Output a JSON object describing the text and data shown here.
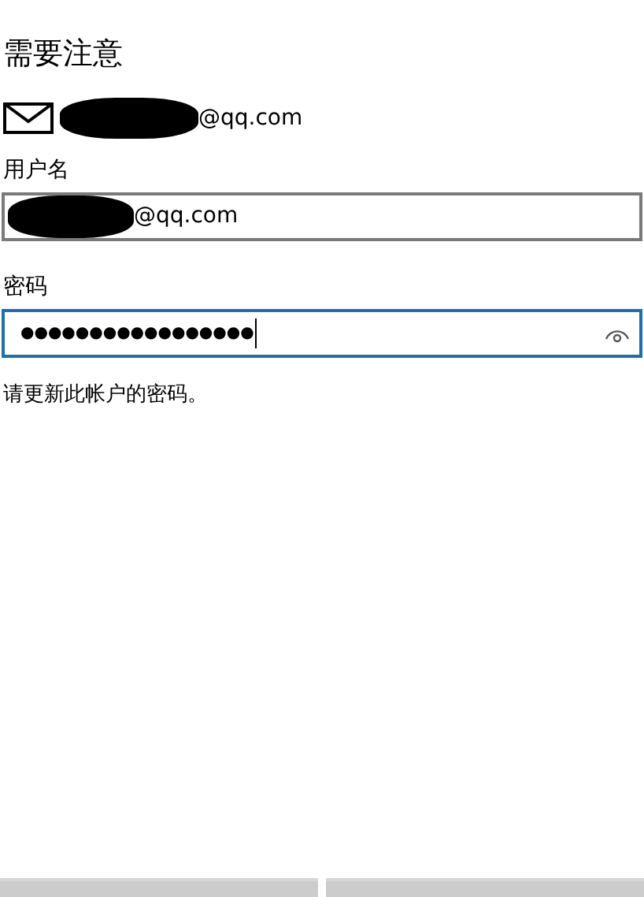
{
  "title": "需要注意",
  "account": {
    "email_visible": "@qq.com",
    "redacted": true
  },
  "username": {
    "label": "用户名",
    "value": "@qq.com",
    "redacted": true,
    "focused": false
  },
  "password": {
    "label": "密码",
    "value": "●●●●●●●●●●●●●●●●●",
    "focused": true
  },
  "message": "请更新此帐户的密码。",
  "buttons": [
    {
      "kind": "plain"
    },
    {
      "kind": "plain"
    }
  ]
}
